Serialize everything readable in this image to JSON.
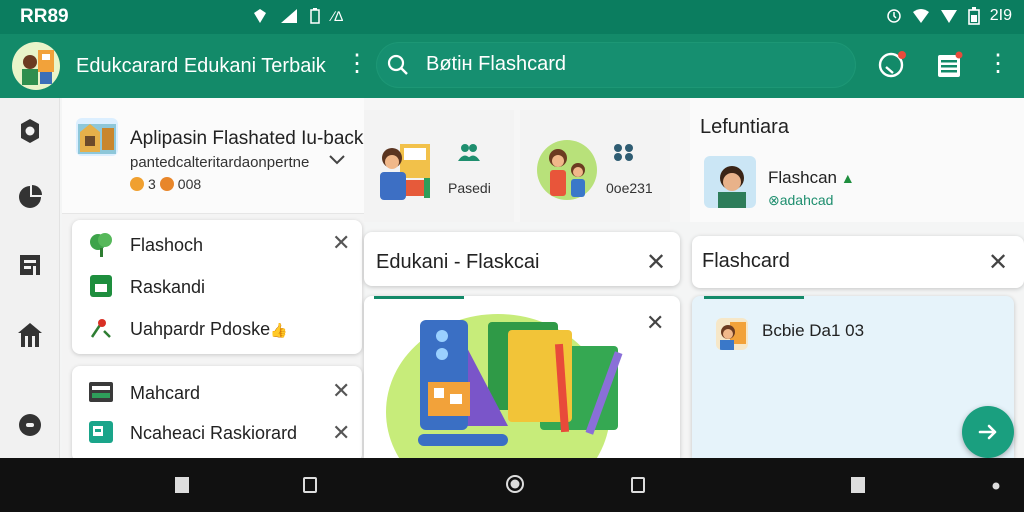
{
  "status_bar": {
    "carrier": "RR89",
    "left_extra": "∕∆",
    "time": "2I9"
  },
  "app_bar": {
    "title": "Edukcarard Edukani Terbaik",
    "search_query": "Bøtiн  Flashcard"
  },
  "rail": {
    "items": [
      "gear-icon",
      "chart-icon",
      "deck-icon",
      "home-icon",
      "record-icon"
    ]
  },
  "recommended": {
    "title": "Aplipasin Flashated Iu-back",
    "subtitle": "pantedcalteritardaonpertne",
    "count": "008",
    "badge_numeral": "3"
  },
  "menu_card_1": {
    "items": [
      {
        "label": "Flashoch",
        "icon": "tree-icon"
      },
      {
        "label": "Raskandi",
        "icon": "square-icon"
      },
      {
        "label": "Uahpardr Pdoske",
        "icon": "pin-icon",
        "suffix": "👍"
      }
    ]
  },
  "menu_card_2": {
    "items": [
      {
        "label": "Mahcard",
        "icon": "card-stack-icon"
      },
      {
        "label": "Ncaheaci Raskiorard",
        "icon": "chat-card-icon"
      }
    ]
  },
  "decks": [
    {
      "count": "Pasedi",
      "icon": "people-icon"
    },
    {
      "count": "0oe231",
      "icon": "group-icon"
    }
  ],
  "dialog_1": {
    "title": "Edukani - Flaskcai"
  },
  "panel_right": {
    "header": "Lefuntiara",
    "item_title": "Flashcan",
    "item_sub": "adahcad"
  },
  "dialog_2": {
    "title": "Flashcard",
    "entry": "Bcbie Da1 03"
  },
  "colors": {
    "primary": "#138a69",
    "status": "#0b7d5f",
    "fab": "#1a9f7f"
  }
}
